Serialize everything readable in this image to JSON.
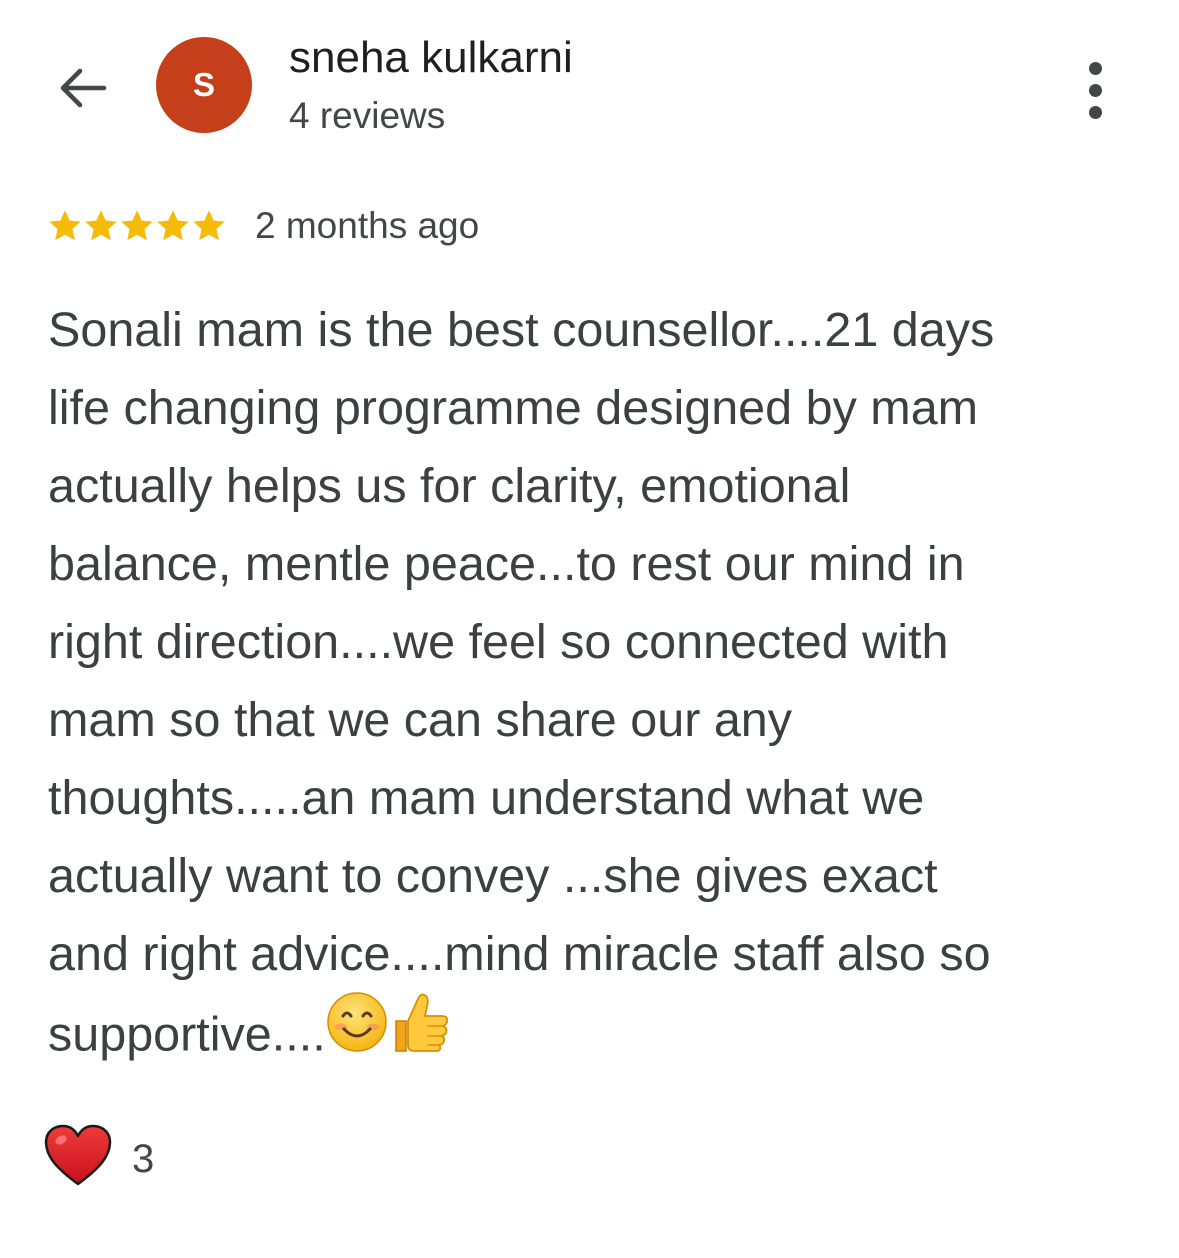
{
  "header": {
    "back_icon": "arrow-back-icon",
    "avatar_initial": "S",
    "avatar_color": "#c5401a",
    "user_name": "sneha kulkarni",
    "review_count": "4 reviews",
    "more_icon": "more-vert-icon"
  },
  "review": {
    "rating": 5,
    "rating_max": 5,
    "star_color": "#f6bb06",
    "date": "2 months ago",
    "text_lines": [
      "Sonali mam is the best counsellor....21 days",
      "life changing programme designed by mam",
      "actually helps us for clarity, emotional",
      "balance, mentle peace...to rest our mind in",
      "right direction....we feel so connected with",
      "mam so that we can share our any",
      "thoughts.....an mam understand what we",
      "actually want to convey ...she gives exact",
      "and right advice....mind miracle staff also so",
      "supportive...."
    ],
    "trailing_emojis": [
      "smiling-face-emoji",
      "thumbs-up-emoji"
    ]
  },
  "reactions": {
    "icon": "red-heart-icon",
    "count": "3"
  }
}
